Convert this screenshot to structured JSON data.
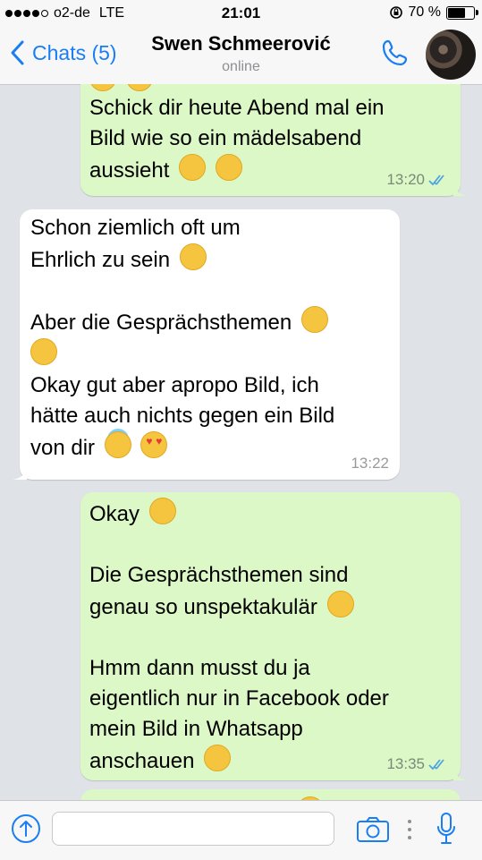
{
  "status": {
    "carrier": "o2-de",
    "network": "LTE",
    "time": "21:01",
    "battery": "70 %",
    "battery_level": 0.7
  },
  "header": {
    "back_label": "Chats (5)",
    "contact_name": "Swen Schmeerović",
    "contact_status": "online"
  },
  "messages": [
    {
      "direction": "out",
      "lines": [
        "Schick dir heute Abend mal ein",
        "Bild wie so ein mädelsabend",
        "aussieht"
      ],
      "time": "13:20"
    },
    {
      "direction": "in",
      "lines": [
        "Schon ziemlich oft um",
        "Ehrlich zu sein",
        "",
        "Aber die Gesprächsthemen",
        "",
        "Okay gut aber apropo Bild, ich",
        "hätte auch nichts gegen ein Bild",
        "von dir"
      ],
      "time": "13:22"
    },
    {
      "direction": "out",
      "lines": [
        "Okay",
        "",
        "Die Gesprächsthemen sind",
        "genau so unspektakulär",
        "",
        "Hmm dann musst du ja",
        "eigentlich nur in Facebook oder",
        "mein Bild in Whatsapp",
        "anschauen"
      ],
      "time": "13:35"
    }
  ],
  "input": {
    "placeholder": ""
  },
  "colors": {
    "accent": "#1a7ef2",
    "bubble_out": "#dcf8c6",
    "bubble_in": "#ffffff",
    "chat_bg": "#dfe2e6",
    "read_ticks": "#4fa3e0"
  }
}
